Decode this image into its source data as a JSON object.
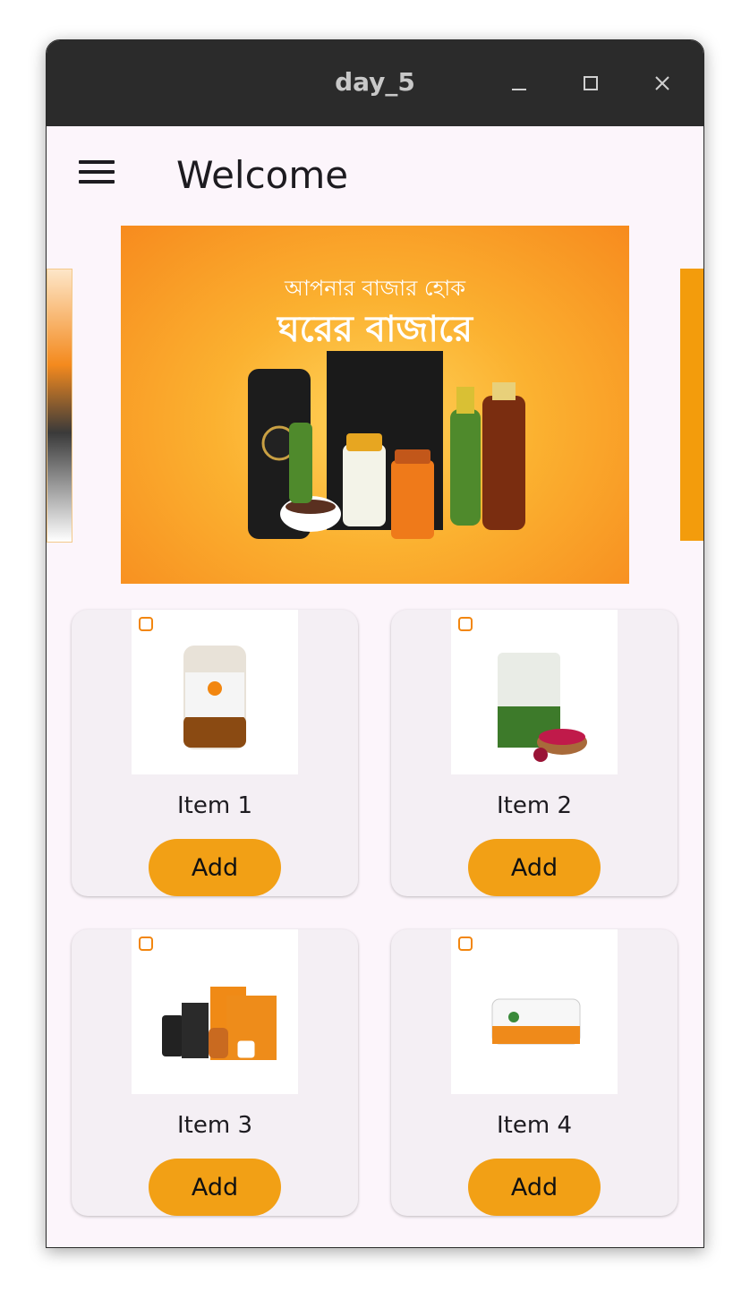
{
  "window": {
    "title": "day_5",
    "minimize_icon": "minimize-icon",
    "maximize_icon": "maximize-icon",
    "close_icon": "close-icon"
  },
  "appbar": {
    "menu_icon": "hamburger-menu-icon",
    "title": "Welcome"
  },
  "carousel": {
    "banner_text_line1": "আপনার বাজার হোক",
    "banner_text_line2": "ঘরের বাজারে"
  },
  "products": [
    {
      "name": "Item 1",
      "button": "Add"
    },
    {
      "name": "Item 2",
      "button": "Add"
    },
    {
      "name": "Item 3",
      "button": "Add"
    },
    {
      "name": "Item 4",
      "button": "Add"
    }
  ],
  "colors": {
    "accent": "#f2a015",
    "background": "#fcf5fb",
    "card": "#f4eff4",
    "titlebar": "#2b2b2b"
  }
}
